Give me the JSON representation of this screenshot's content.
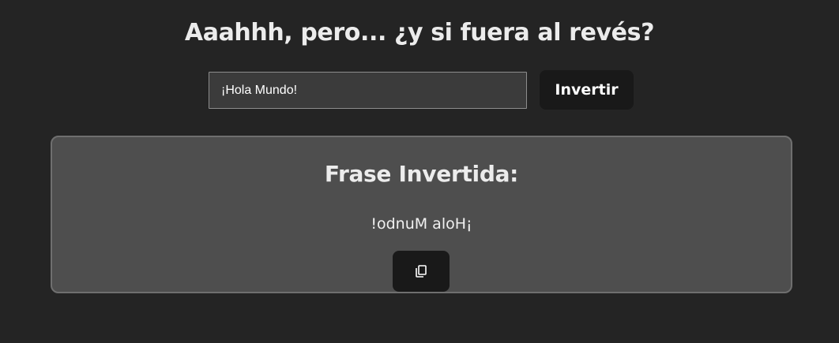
{
  "header": {
    "title": "Aaahhh, pero... ¿y si fuera al revés?"
  },
  "form": {
    "input_value": "¡Hola Mundo!",
    "invert_label": "Invertir"
  },
  "result": {
    "heading": "Frase Invertida:",
    "text": "!odnuM aloH¡",
    "copy_icon": "copy-icon"
  }
}
